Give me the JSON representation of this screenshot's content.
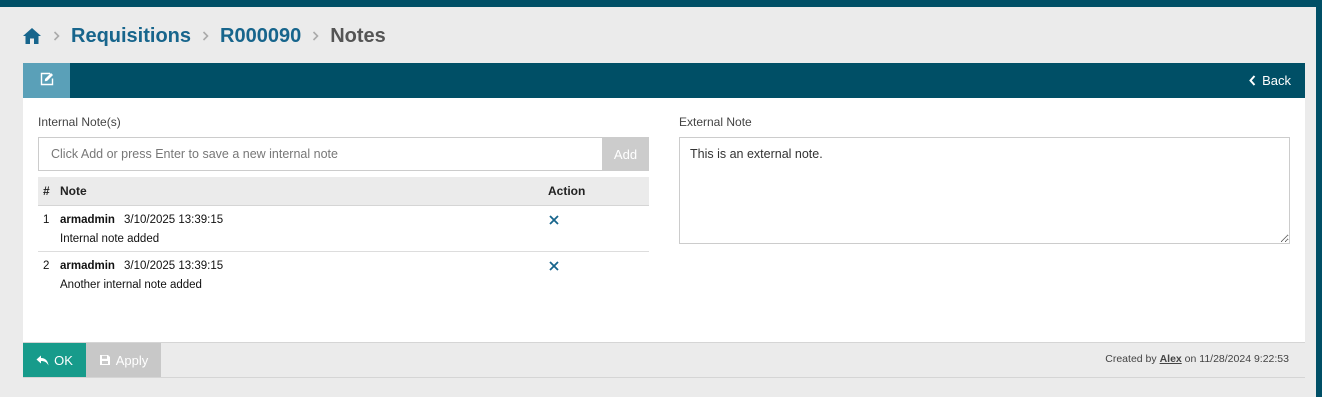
{
  "colors": {
    "primary_dark": "#004f66",
    "link": "#17658c",
    "edit_tab": "#5aa0b8",
    "ok_button": "#179b8b",
    "disabled": "#c8c8c8",
    "delete_icon": "#17658c"
  },
  "breadcrumb": {
    "home_icon": "home-icon",
    "items": [
      {
        "label": "Requisitions"
      },
      {
        "label": "R000090"
      },
      {
        "label": "Notes"
      }
    ]
  },
  "header": {
    "edit_icon": "edit-icon",
    "back_label": "Back"
  },
  "internal": {
    "label": "Internal Note(s)",
    "input_placeholder": "Click Add or press Enter to save a new internal note",
    "input_value": "",
    "add_label": "Add",
    "columns": [
      "#",
      "Note",
      "Action"
    ],
    "rows": [
      {
        "num": "1",
        "author": "armadmin",
        "date": "3/10/2025 13:39:15",
        "text": "Internal note added"
      },
      {
        "num": "2",
        "author": "armadmin",
        "date": "3/10/2025 13:39:15",
        "text": "Another internal note added"
      }
    ]
  },
  "external": {
    "label": "External Note",
    "value": "This is an external note."
  },
  "footer": {
    "ok_label": "OK",
    "apply_label": "Apply",
    "created_prefix": "Created by",
    "created_user": "Alex",
    "created_suffix": "on 11/28/2024 9:22:53"
  }
}
